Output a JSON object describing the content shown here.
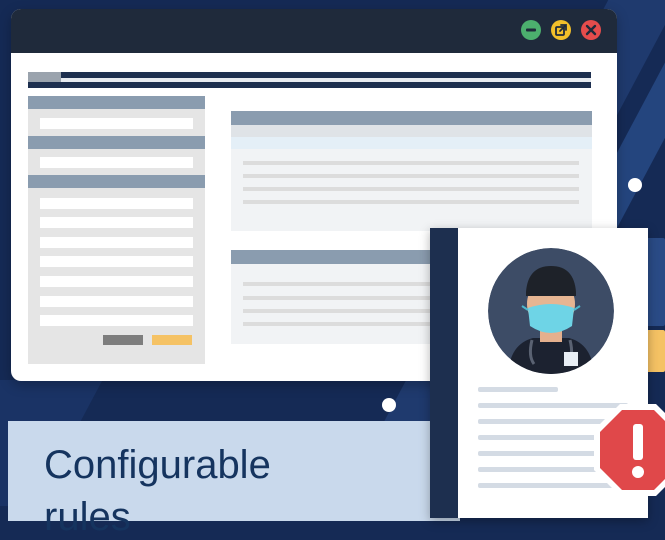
{
  "caption": {
    "line1": "Configurable",
    "line2": "rules"
  },
  "icons": {
    "minimize": "minimize-icon",
    "popout": "popout-icon",
    "close": "close-icon",
    "alert": "alert-octagon-icon",
    "doctor": "doctor-avatar-icon"
  },
  "colors": {
    "background": "#152a55",
    "titlebar": "#1f2a3b",
    "minimize": "#4caf6e",
    "popout": "#f2bf2a",
    "close": "#e54c4c",
    "accent_button": "#f5c264",
    "alert": "#e0484a",
    "caption_bg": "#c9d9ec",
    "caption_text": "#15345f"
  }
}
